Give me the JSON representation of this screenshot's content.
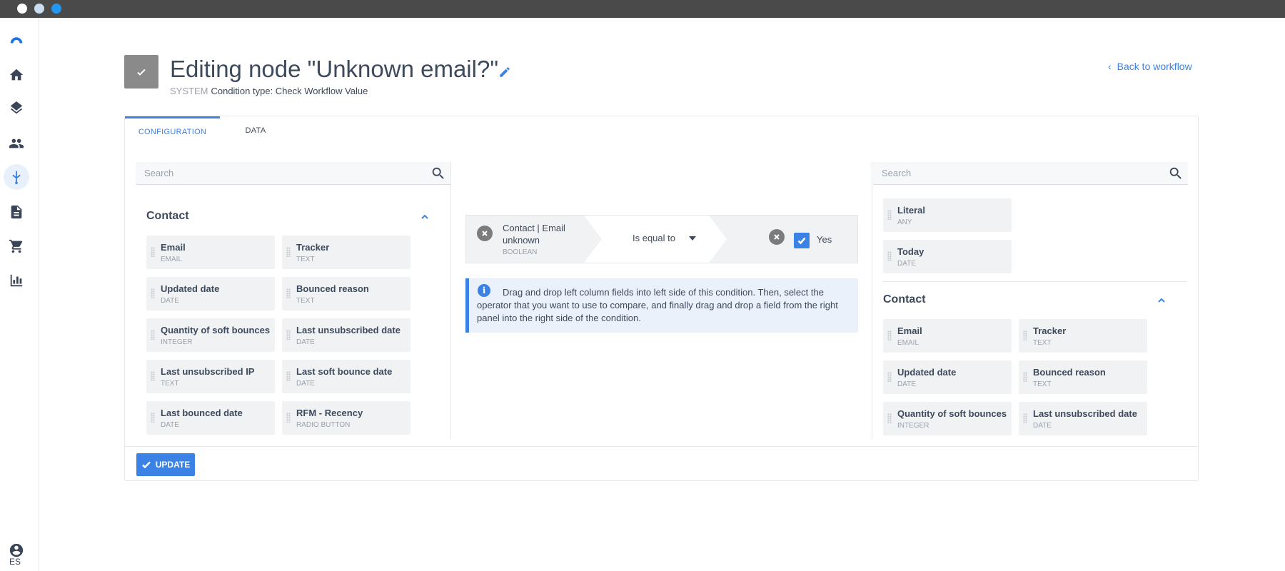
{
  "window": {
    "controls": [
      "close",
      "minimize",
      "maximize"
    ]
  },
  "sidebar": {
    "items": [
      {
        "icon": "logo-icon"
      },
      {
        "icon": "home-icon"
      },
      {
        "icon": "layers-icon"
      },
      {
        "icon": "people-icon"
      },
      {
        "icon": "workflow-icon",
        "active": true
      },
      {
        "icon": "document-icon"
      },
      {
        "icon": "cart-icon"
      },
      {
        "icon": "chart-icon"
      }
    ],
    "user_icon": "account-icon",
    "language": "ES"
  },
  "header": {
    "title": "Editing node \"Unknown email?\"",
    "system_label": "SYSTEM",
    "condition_type": "Condition type: Check Workflow Value",
    "back_link": "Back to workflow"
  },
  "tabs": [
    {
      "label": "CONFIGURATION",
      "active": true
    },
    {
      "label": "DATA",
      "active": false
    }
  ],
  "left_panel": {
    "search_placeholder": "Search",
    "group_title": "Contact",
    "fields": [
      {
        "name": "Email",
        "type": "EMAIL"
      },
      {
        "name": "Tracker",
        "type": "TEXT"
      },
      {
        "name": "Updated date",
        "type": "DATE"
      },
      {
        "name": "Bounced reason",
        "type": "TEXT"
      },
      {
        "name": "Quantity of soft bounces",
        "type": "INTEGER"
      },
      {
        "name": "Last unsubscribed date",
        "type": "DATE"
      },
      {
        "name": "Last unsubscribed IP",
        "type": "TEXT"
      },
      {
        "name": "Last soft bounce date",
        "type": "DATE"
      },
      {
        "name": "Last bounced date",
        "type": "DATE"
      },
      {
        "name": "RFM - Recency",
        "type": "RADIO BUTTON"
      }
    ]
  },
  "condition": {
    "left_field": "Contact | Email unknown",
    "left_type": "BOOLEAN",
    "operator": "Is equal to",
    "right_value": "Yes",
    "right_checked": true
  },
  "info": {
    "text": "Drag and drop left column fields into left side of this condition. Then, select the operator that you want to use to compare, and finally drag and drop a field from the right panel into the right side of the condition."
  },
  "right_panel": {
    "search_placeholder": "Search",
    "literals": [
      {
        "name": "Literal",
        "type": "ANY"
      },
      {
        "name": "Today",
        "type": "DATE"
      }
    ],
    "group_title": "Contact",
    "fields": [
      {
        "name": "Email",
        "type": "EMAIL"
      },
      {
        "name": "Tracker",
        "type": "TEXT"
      },
      {
        "name": "Updated date",
        "type": "DATE"
      },
      {
        "name": "Bounced reason",
        "type": "TEXT"
      },
      {
        "name": "Quantity of soft bounces",
        "type": "INTEGER"
      },
      {
        "name": "Last unsubscribed date",
        "type": "DATE"
      }
    ]
  },
  "footer": {
    "update_label": "UPDATE"
  },
  "colors": {
    "accent": "#3b82e6",
    "text": "#3d4a5c",
    "muted": "#9aa1ad",
    "field_bg": "#f1f2f4"
  }
}
